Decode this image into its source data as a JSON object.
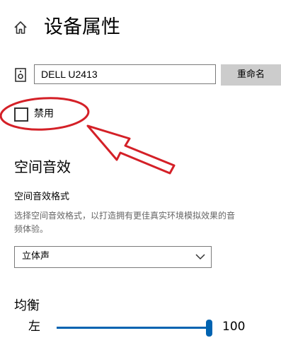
{
  "header": {
    "title": "设备属性",
    "home_icon": "home-icon"
  },
  "device": {
    "icon": "speaker-icon",
    "name_value": "DELL U2413",
    "rename_label": "重命名"
  },
  "disable": {
    "label": "禁用",
    "checked": false
  },
  "annotation": {
    "color": "#d42027",
    "shapes": [
      "ellipse-highlight",
      "arrow"
    ]
  },
  "spatial_audio": {
    "heading": "空间音效",
    "format_label": "空间音效格式",
    "description_line1": "选择空间音效格式，以打造拥有更佳真实环境模拟效果的音",
    "description_line2": "频体验。",
    "select_value": "立体声"
  },
  "balance": {
    "heading": "均衡",
    "left_label": "左",
    "value": "100",
    "accent_color": "#0063b1"
  }
}
